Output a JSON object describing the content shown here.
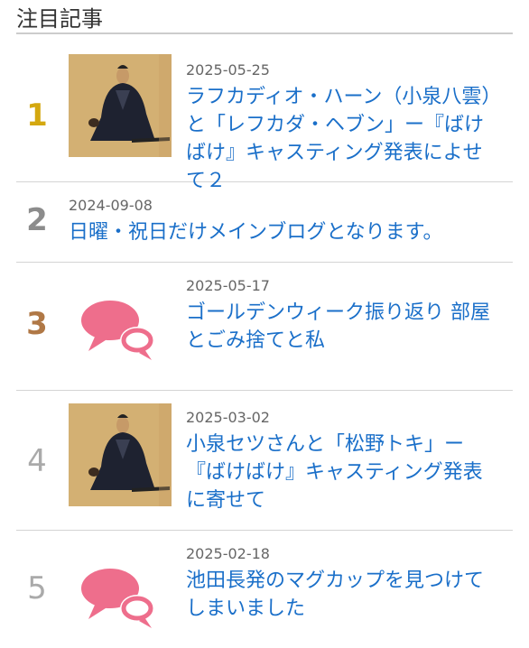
{
  "section": {
    "title": "注目記事"
  },
  "items": [
    {
      "rank": "1",
      "rank_color": "#d4a810",
      "thumb": "portrait",
      "date": "2025-05-25",
      "title": "ラフカディオ・ハーン（小泉八雲）と「レフカダ・ヘブン」ー『ばけばけ』キャスティング発表によせて２"
    },
    {
      "rank": "2",
      "rank_color": "#8c8c8c",
      "thumb": "none",
      "date": "2024-09-08",
      "title": "日曜・祝日だけメインブログとなります。"
    },
    {
      "rank": "3",
      "rank_color": "#b07846",
      "thumb": "speech-bubbles-icon",
      "date": "2025-05-17",
      "title": "ゴールデンウィーク振り返り 部屋とごみ捨てと私"
    },
    {
      "rank": "4",
      "rank_color": "#aaaaaa",
      "thumb": "portrait",
      "date": "2025-03-02",
      "title": "小泉セツさんと「松野トキ」ー『ばけばけ』キャスティング発表に寄せて"
    },
    {
      "rank": "5",
      "rank_color": "#aaaaaa",
      "thumb": "speech-bubbles-icon",
      "date": "2025-02-18",
      "title": "池田長発のマグカップを見つけてしまいました"
    }
  ],
  "colors": {
    "link": "#1a6fc9",
    "bubble": "#ee6e8c"
  }
}
